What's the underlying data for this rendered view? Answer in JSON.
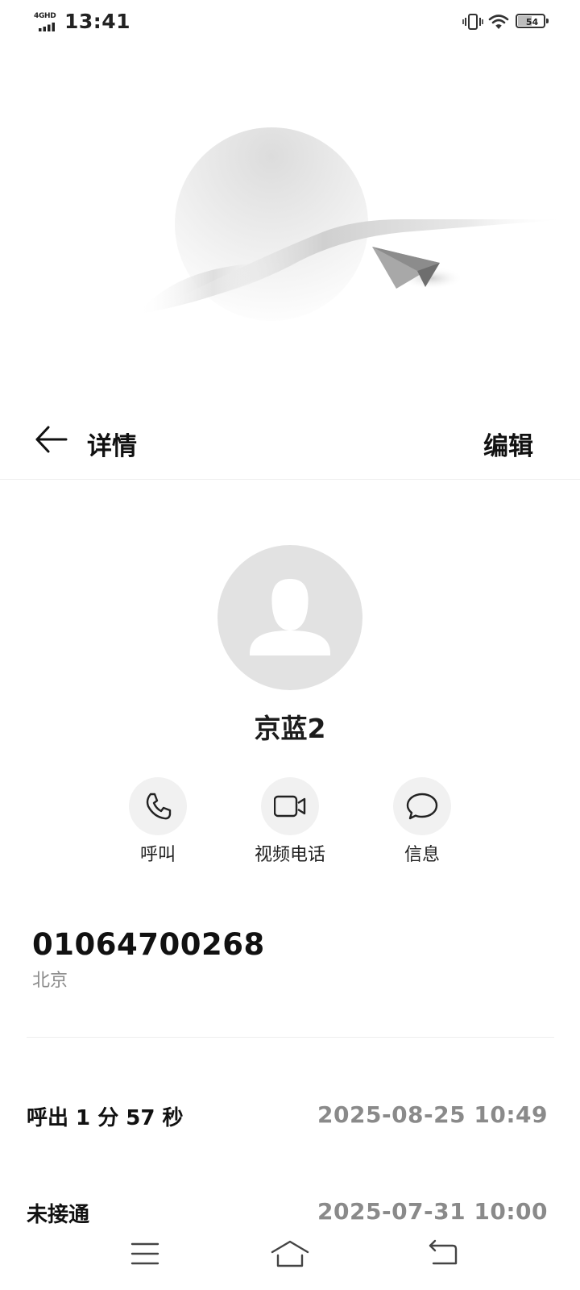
{
  "status_bar": {
    "network": "4GHD",
    "time": "13:41",
    "battery_level": 54,
    "icons": [
      "signal-icon",
      "vibrate-icon",
      "wifi-icon",
      "battery-icon"
    ]
  },
  "header": {
    "title": "详情",
    "edit_label": "编辑",
    "back_icon": "arrow-left-icon"
  },
  "contact": {
    "name": "京蓝2",
    "avatar_icon": "person-icon"
  },
  "actions": [
    {
      "label": "呼叫",
      "icon": "phone-icon"
    },
    {
      "label": "视频电话",
      "icon": "video-camera-icon"
    },
    {
      "label": "信息",
      "icon": "chat-bubble-icon"
    }
  ],
  "phone": {
    "number": "01064700268",
    "location": "北京"
  },
  "records": [
    {
      "type": "呼出 1 分 57 秒",
      "time": "2025-08-25 10:49"
    },
    {
      "type": "未接通",
      "time": "2025-07-31 10:00"
    }
  ],
  "nav_bar": {
    "icons": [
      "menu-icon",
      "home-icon",
      "back-icon"
    ]
  }
}
